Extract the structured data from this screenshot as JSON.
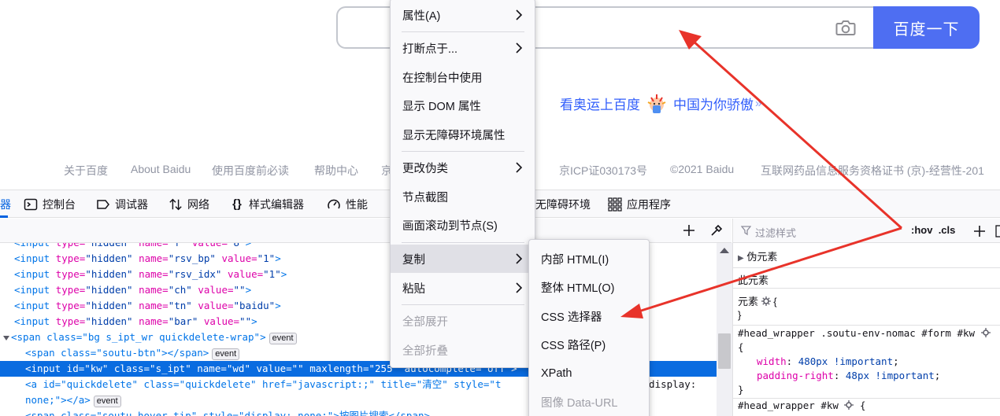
{
  "baidu": {
    "search_button": "百度一下",
    "banner_part1": "看奥运上百度",
    "banner_part2": "中国为你骄傲",
    "banner_chevron": "»",
    "footer_links": [
      "关于百度",
      "About Baidu",
      "使用百度前必读",
      "帮助中心",
      "京",
      "京ICP证030173号",
      "©2021 Baidu",
      "互联网药品信息服务资格证书 (京)-经营性-201"
    ]
  },
  "devtools": {
    "tabs": [
      {
        "label": "器",
        "icon": "inspector-icon"
      },
      {
        "label": "控制台",
        "icon": "console-icon"
      },
      {
        "label": "调试器",
        "icon": "debugger-icon"
      },
      {
        "label": "网络",
        "icon": "network-icon"
      },
      {
        "label": "样式编辑器",
        "icon": "style-editor-icon"
      },
      {
        "label": "性能",
        "icon": "performance-icon"
      },
      {
        "label": "无障碍环境",
        "icon": "accessibility-icon"
      },
      {
        "label": "应用程序",
        "icon": "application-icon"
      }
    ],
    "markup": [
      {
        "tag": "input",
        "attrs": [
          [
            "type",
            "hidden"
          ],
          [
            "name",
            "f"
          ],
          [
            "value",
            "8"
          ]
        ]
      },
      {
        "tag": "input",
        "attrs": [
          [
            "type",
            "hidden"
          ],
          [
            "name",
            "rsv_bp"
          ],
          [
            "value",
            "1"
          ]
        ]
      },
      {
        "tag": "input",
        "attrs": [
          [
            "type",
            "hidden"
          ],
          [
            "name",
            "rsv_idx"
          ],
          [
            "value",
            "1"
          ]
        ]
      },
      {
        "tag": "input",
        "attrs": [
          [
            "type",
            "hidden"
          ],
          [
            "name",
            "ch"
          ],
          [
            "value",
            ""
          ]
        ]
      },
      {
        "tag": "input",
        "attrs": [
          [
            "type",
            "hidden"
          ],
          [
            "name",
            "tn"
          ],
          [
            "value",
            "baidu"
          ]
        ]
      },
      {
        "tag": "input",
        "attrs": [
          [
            "type",
            "hidden"
          ],
          [
            "name",
            "bar"
          ],
          [
            "value",
            ""
          ]
        ]
      }
    ],
    "markup_lines": {
      "span_wrap": "<span class=\"bg s_ipt_wr quickdelete-wrap\">",
      "span_btn": "<span class=\"soutu-btn\"></span>",
      "input_kw": "<input id=\"kw\" class=\"s_ipt\" name=\"wd\" value=\"\" maxlength=\"255\" autocomplete=\"off\">",
      "a_quickdelete": "<a id=\"quickdelete\" class=\"quickdelete\" href=\"javascript:;\" title=\"清空\" style=\"t",
      "a_quickdelete_tail": "; display:",
      "none_line": "none;\"></a>",
      "span_hover": "<span class=\"soutu-hover-tip\" style=\"display: none;\">按图片搜索</span>",
      "event_badge": "event"
    },
    "rules": {
      "filter_placeholder": "过滤样式",
      "hov": ":hov",
      "cls": ".cls",
      "pseudo_elements": "伪元素",
      "this_element": "此元素",
      "element_label": "元素",
      "brace_open": "{",
      "brace_close": "}",
      "selector1": "#head_wrapper .soutu-env-nomac #form #kw",
      "prop1": "width",
      "val1": "480px !important",
      "prop2": "padding-right",
      "val2": "48px !important",
      "selector2": "#head_wrapper #kw"
    }
  },
  "context_menu": {
    "items": [
      {
        "label": "属性(A)",
        "submenu": true,
        "disabled": false
      },
      {
        "label": "打断点于...",
        "submenu": true,
        "disabled": false
      },
      {
        "label": "在控制台中使用",
        "submenu": false,
        "disabled": false
      },
      {
        "label": "显示 DOM 属性",
        "submenu": false,
        "disabled": false
      },
      {
        "label": "显示无障碍环境属性",
        "submenu": false,
        "disabled": false
      },
      {
        "label": "更改伪类",
        "submenu": true,
        "disabled": false
      },
      {
        "label": "节点截图",
        "submenu": false,
        "disabled": false
      },
      {
        "label": "画面滚动到节点(S)",
        "submenu": false,
        "disabled": false
      },
      {
        "label": "复制",
        "submenu": true,
        "disabled": false,
        "highlighted": true
      },
      {
        "label": "粘贴",
        "submenu": true,
        "disabled": false
      },
      {
        "label": "全部展开",
        "submenu": false,
        "disabled": true
      },
      {
        "label": "全部折叠",
        "submenu": false,
        "disabled": true
      }
    ]
  },
  "copy_submenu": {
    "items": [
      {
        "label": "内部 HTML(I)",
        "disabled": false
      },
      {
        "label": "整体 HTML(O)",
        "disabled": false
      },
      {
        "label": "CSS 选择器",
        "disabled": false
      },
      {
        "label": "CSS 路径(P)",
        "disabled": false
      },
      {
        "label": "XPath",
        "disabled": false
      },
      {
        "label": "图像 Data-URL",
        "disabled": true
      }
    ]
  },
  "colors": {
    "baidu_blue": "#4e6ef2",
    "selection_blue": "#0a6ce0",
    "annotation_red": "#e8332a"
  }
}
